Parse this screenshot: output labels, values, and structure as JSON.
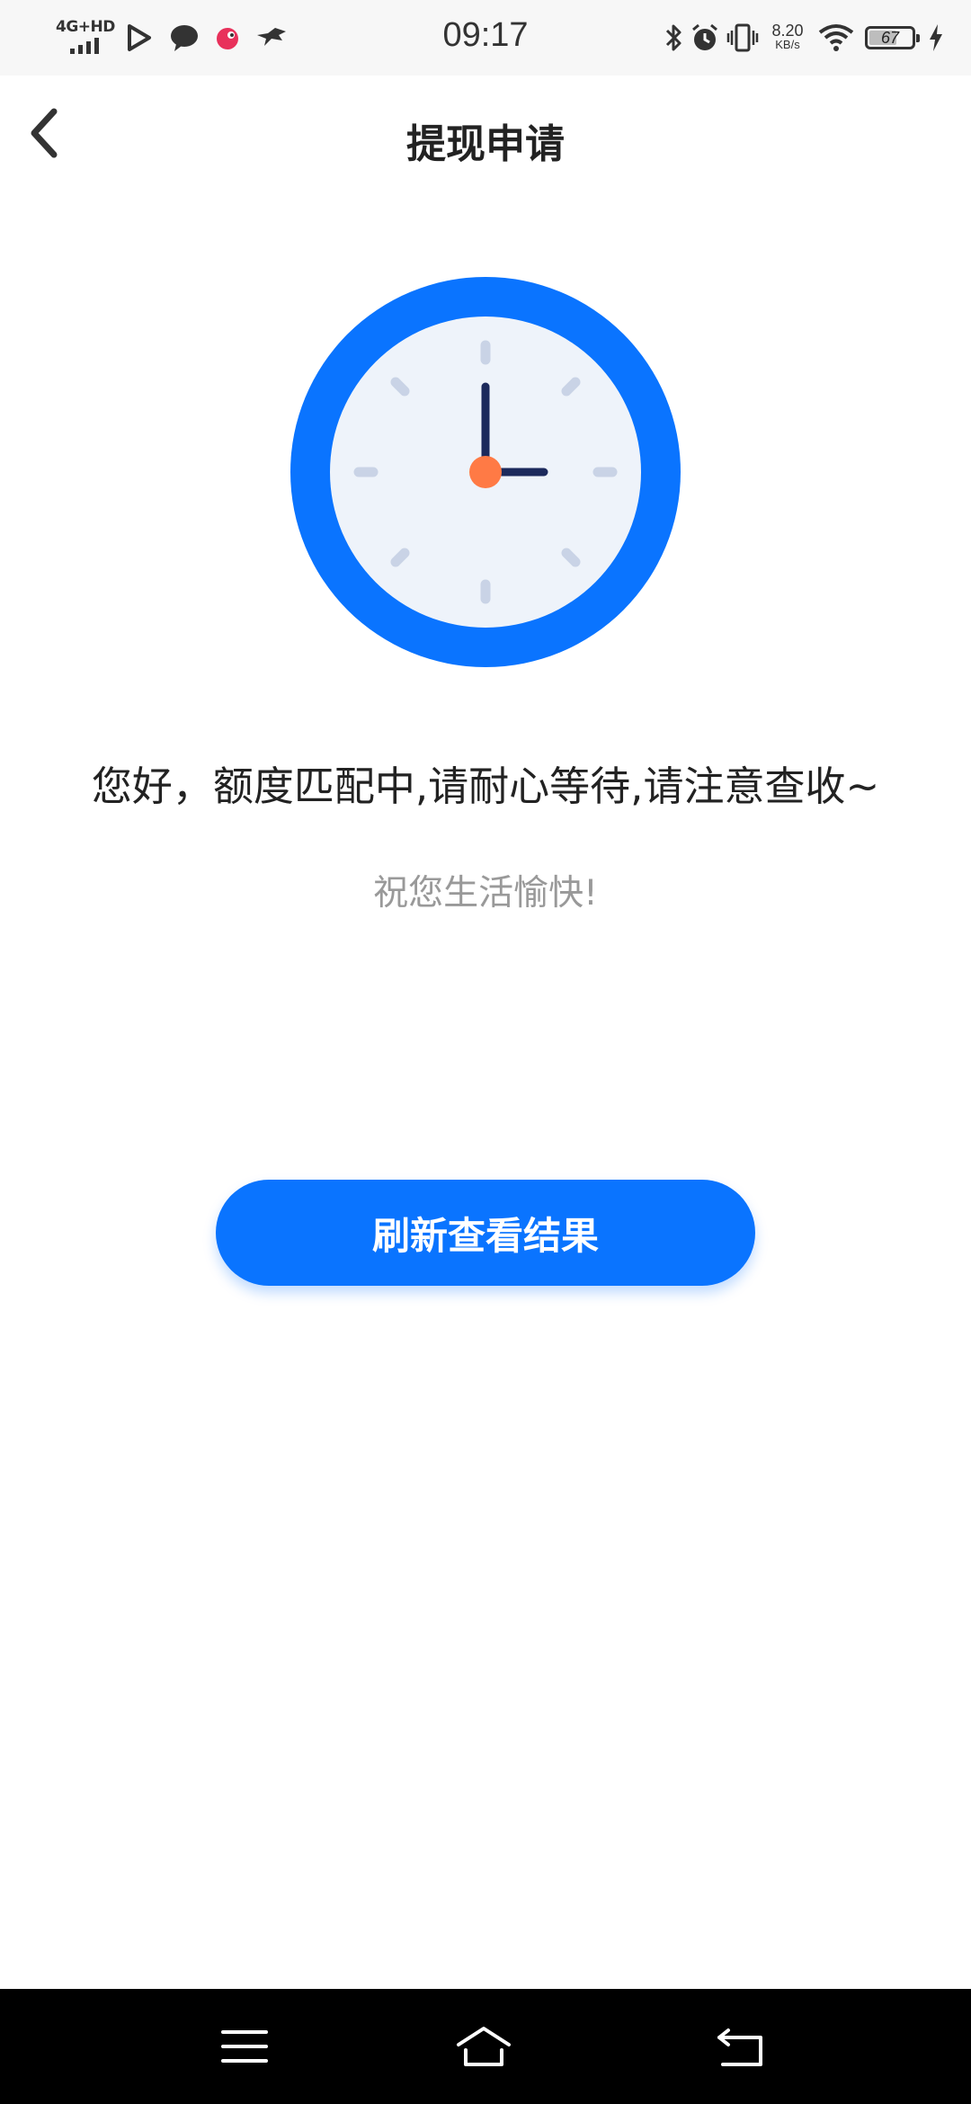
{
  "status_bar": {
    "network": "4G+HD",
    "time": "09:17",
    "speed_value": "8.20",
    "speed_unit": "KB/s",
    "battery_level": "67",
    "battery_fraction": 0.67,
    "icons": [
      "signal-bars-icon",
      "play-icon",
      "chat-bubble-icon",
      "app-badge-icon",
      "bird-icon",
      "bluetooth-icon",
      "alarm-icon",
      "vibrate-icon",
      "wifi-icon",
      "battery-icon",
      "charging-icon"
    ]
  },
  "header": {
    "back_icon": "chevron-left-icon",
    "title": "提现申请"
  },
  "main": {
    "illustration": "clock-icon",
    "message": "您好，额度匹配中,请耐心等待,请注意查收~",
    "sub_message": "祝您生活愉快!",
    "refresh_button": "刷新查看结果"
  },
  "system_nav": {
    "items": [
      "menu-icon",
      "home-icon",
      "back-icon"
    ]
  },
  "colors": {
    "primary": "#0a74ff",
    "clock_face": "#eef3fa",
    "clock_hands": "#1c2a5c",
    "clock_center": "#ff7a45",
    "clock_ticks": "#c9d3e6",
    "text_main": "#222222",
    "text_muted": "#999999"
  }
}
